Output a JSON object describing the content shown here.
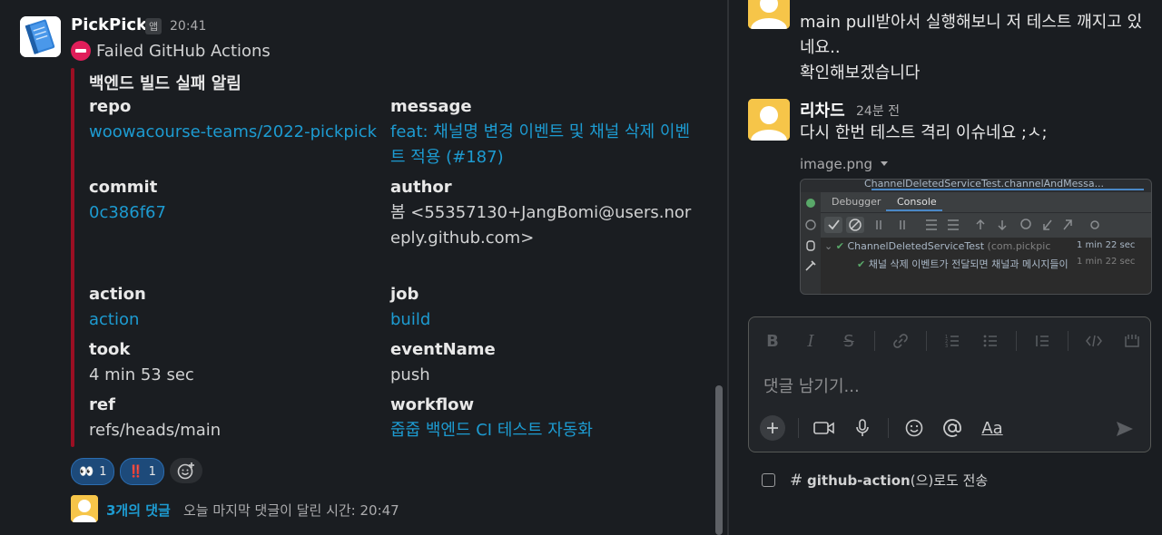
{
  "message": {
    "sender": "PickPick",
    "app_tag": "앱",
    "time": "20:41",
    "status_text": "Failed GitHub Actions",
    "attachment": {
      "title": "백엔드 빌드 실패 알림",
      "fields": [
        {
          "label": "repo",
          "value": "woowacourse-teams/2022-pickpick",
          "link": true
        },
        {
          "label": "message",
          "value": "feat: 채널명 변경 이벤트 및 채널 삭제 이벤트 적용 (#187)",
          "link": true
        },
        {
          "label": "commit",
          "value": "0c386f67",
          "link": true
        },
        {
          "label": "author",
          "value": "봄 <55357130+JangBomi@users.noreply.github.com>",
          "link": false
        },
        {
          "label": "action",
          "value": "action",
          "link": true
        },
        {
          "label": "job",
          "value": "build",
          "link": true
        },
        {
          "label": "took",
          "value": "4 min 53 sec",
          "link": false
        },
        {
          "label": "eventName",
          "value": "push",
          "link": false
        },
        {
          "label": "ref",
          "value": "refs/heads/main",
          "link": false
        },
        {
          "label": "workflow",
          "value": "줍줍 백엔드 CI 테스트 자동화",
          "link": true
        }
      ]
    },
    "reactions": [
      {
        "emoji": "👀",
        "count": "1"
      },
      {
        "emoji": "‼️",
        "count": "1"
      }
    ],
    "thread": {
      "count": "3개의 댓글",
      "last_reply": "오늘 마지막 댓글이 달린 시간: 20:47"
    }
  },
  "thread_panel": {
    "reply1": {
      "text_lines": [
        "main pull받아서 실행해보니 저 테스트 깨지고 있",
        "네요..",
        "확인해보겠습니다"
      ]
    },
    "reply2": {
      "author": "리차드",
      "time": "24분 전",
      "text": "다시 한번 테스트 격리 이슈네요 ;ㅅ;",
      "image_name": "image.png",
      "screenshot": {
        "top_text": "ChannelDeletedServiceTest.channelAndMessa...",
        "tabs": [
          "Debugger",
          "Console"
        ],
        "row1_name": "ChannelDeletedServiceTest",
        "row1_pkg": "(com.pickpic",
        "row1_time": "1 min 22 sec",
        "row2_name": "채널 삭제 이벤트가 전달되면 채널과 메시지들이",
        "row2_time": "1 min 22 sec"
      }
    },
    "composer": {
      "placeholder": "댓글 남기기...",
      "format_label": "Aa"
    },
    "also_send": {
      "channel": "github-action",
      "suffix": "(으)로도 전송"
    }
  },
  "colors": {
    "background": "#1a1d21",
    "link": "#1d9bd1",
    "attachment_bar": "#9b0f23",
    "reaction_bg": "#1d4a7a",
    "avatar_yellow": "#f6c549"
  }
}
